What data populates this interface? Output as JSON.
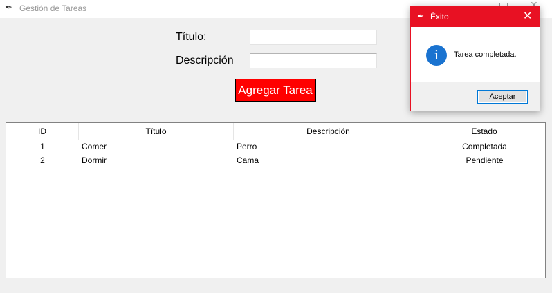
{
  "window": {
    "title": "Gestión de Tareas",
    "app_icon": "feather-icon"
  },
  "form": {
    "title_label": "Título:",
    "title_value": "",
    "description_label": "Descripción",
    "description_value": "",
    "add_button_label": "Agregar Tarea",
    "add_button_color": "#ff0000"
  },
  "table": {
    "columns": [
      "ID",
      "Título",
      "Descripción",
      "Estado"
    ],
    "rows": [
      {
        "id": "1",
        "title": "Comer",
        "description": "Perro",
        "status": "Completada"
      },
      {
        "id": "2",
        "title": "Dormir",
        "description": "Cama",
        "status": "Pendiente"
      }
    ]
  },
  "dialog": {
    "title": "Éxito",
    "message": "Tarea completada.",
    "icon": "info-icon",
    "ok_label": "Aceptar",
    "accent_color": "#e81123"
  }
}
